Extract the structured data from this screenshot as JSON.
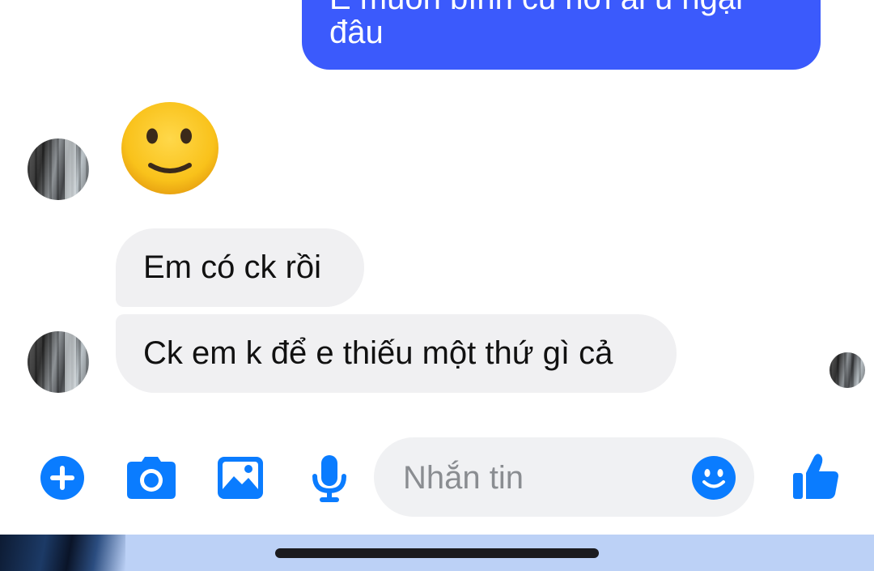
{
  "messages": {
    "sent": {
      "line1": "E muốn bình cũ nơi ai u ngại",
      "line2": "đâu"
    },
    "received": [
      {
        "text": "Em có ck rồi"
      },
      {
        "text": "Ck em k để e thiếu một thứ gì cả"
      }
    ]
  },
  "composer": {
    "placeholder": "Nhắn tin",
    "icons": [
      "plus-icon",
      "camera-icon",
      "image-icon",
      "microphone-icon",
      "smiley-icon",
      "thumbs-up-icon"
    ]
  },
  "colors": {
    "accent": "#0a7cff",
    "sent_bubble": "#3b5afc",
    "received_bubble": "#f0f0f2",
    "emoji_yellow": "#fcc21b"
  }
}
